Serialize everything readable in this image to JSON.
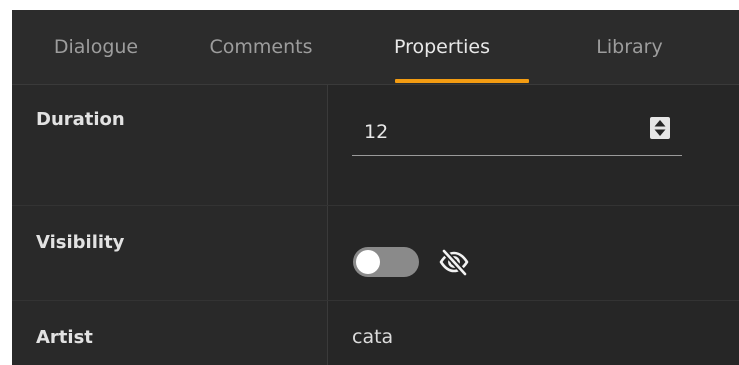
{
  "tabs": [
    {
      "label": "Dialogue",
      "active": false
    },
    {
      "label": "Comments",
      "active": false
    },
    {
      "label": "Properties",
      "active": true
    },
    {
      "label": "Library",
      "active": false
    }
  ],
  "colors": {
    "panel_background": "#262626",
    "label_background": "#292929",
    "accent": "#f39c12",
    "text_primary": "#e8e8e8",
    "text_muted": "#9d9d9d"
  },
  "properties": {
    "duration": {
      "label": "Duration",
      "value": "12",
      "control": "number-stepper",
      "icon": "stepper-icon"
    },
    "visibility": {
      "label": "Visibility",
      "toggle_on": false,
      "icon": "eye-slash-icon"
    },
    "artist": {
      "label": "Artist",
      "value": "cata"
    }
  }
}
